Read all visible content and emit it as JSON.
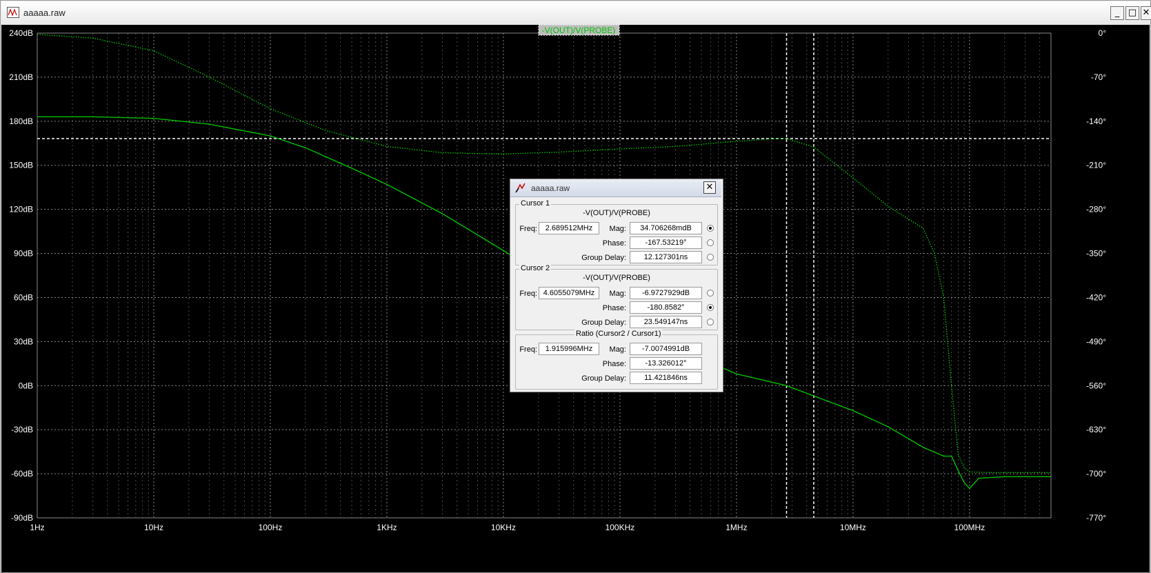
{
  "window": {
    "title": "aaaaa.raw",
    "buttons": {
      "minimize": "_",
      "maximize": "□",
      "close": "✕"
    },
    "app_icon": "waveform-viewer-icon"
  },
  "colors": {
    "background": "#000000",
    "grid": "#8a8a8a",
    "trace": "#00d000",
    "axis_text": "#ffffff",
    "trace_label_bg": "#bdbdbd"
  },
  "chart_data": {
    "type": "line",
    "trace_label": "-V(OUT)/V(PROBE)",
    "x_scale": "log",
    "x_unit": "Hz",
    "x_range": [
      1,
      500000000
    ],
    "x_ticks": [
      {
        "value": 1,
        "label": "1Hz"
      },
      {
        "value": 10,
        "label": "10Hz"
      },
      {
        "value": 100,
        "label": "100Hz"
      },
      {
        "value": 1000,
        "label": "1KHz"
      },
      {
        "value": 10000,
        "label": "10KHz"
      },
      {
        "value": 100000,
        "label": "100KHz"
      },
      {
        "value": 1000000,
        "label": "1MHz"
      },
      {
        "value": 10000000,
        "label": "10MHz"
      },
      {
        "value": 100000000,
        "label": "100MHz"
      }
    ],
    "y_left_range": [
      -90,
      240
    ],
    "y_left_ticks": [
      {
        "value": 240,
        "label": "240dB"
      },
      {
        "value": 210,
        "label": "210dB"
      },
      {
        "value": 180,
        "label": "180dB"
      },
      {
        "value": 150,
        "label": "150dB"
      },
      {
        "value": 120,
        "label": "120dB"
      },
      {
        "value": 90,
        "label": "90dB"
      },
      {
        "value": 60,
        "label": "60dB"
      },
      {
        "value": 30,
        "label": "30dB"
      },
      {
        "value": 0,
        "label": "0dB"
      },
      {
        "value": -30,
        "label": "-30dB"
      },
      {
        "value": -60,
        "label": "-60dB"
      },
      {
        "value": -90,
        "label": "-90dB"
      }
    ],
    "y_right_range": [
      -770,
      0
    ],
    "y_right_ticks": [
      {
        "value": 0,
        "label": "0°"
      },
      {
        "value": -70,
        "label": "-70°"
      },
      {
        "value": -140,
        "label": "-140°"
      },
      {
        "value": -210,
        "label": "-210°"
      },
      {
        "value": -280,
        "label": "-280°"
      },
      {
        "value": -350,
        "label": "-350°"
      },
      {
        "value": -420,
        "label": "-420°"
      },
      {
        "value": -490,
        "label": "-490°"
      },
      {
        "value": -560,
        "label": "-560°"
      },
      {
        "value": -630,
        "label": "-630°"
      },
      {
        "value": -700,
        "label": "-700°"
      },
      {
        "value": -770,
        "label": "-770°"
      }
    ],
    "grid": true,
    "cursors": {
      "vertical_freqs": [
        2689512,
        4605507.9
      ],
      "horizontal_phase": -167.53219
    },
    "series": [
      {
        "axis": "left",
        "style": "solid",
        "x": [
          1,
          3,
          10,
          30,
          100,
          200,
          500,
          1000,
          3000,
          10000,
          30000,
          100000,
          300000,
          1000000,
          2689512,
          4605507.9,
          10000000,
          20000000,
          40000000,
          60000000,
          70000000,
          80000000,
          90000000,
          100000000,
          120000000,
          200000000,
          500000000
        ],
        "y": [
          183,
          183,
          182,
          178,
          170,
          162,
          148,
          137,
          117,
          92,
          68,
          45,
          26,
          8,
          0,
          -7,
          -17,
          -28,
          -42,
          -48,
          -48,
          -58,
          -66,
          -70,
          -63,
          -62,
          -62
        ]
      },
      {
        "axis": "right",
        "style": "dotted",
        "x": [
          1,
          3,
          10,
          30,
          100,
          300,
          1000,
          3000,
          10000,
          30000,
          100000,
          300000,
          1000000,
          2000000,
          2689512,
          4605507.9,
          10000000,
          20000000,
          40000000,
          50000000,
          60000000,
          70000000,
          80000000,
          90000000,
          100000000,
          150000000,
          500000000
        ],
        "y": [
          -2,
          -8,
          -28,
          -70,
          -120,
          -155,
          -180,
          -190,
          -192,
          -189,
          -184,
          -180,
          -172,
          -168,
          -167.5,
          -180.9,
          -230,
          -275,
          -310,
          -350,
          -420,
          -560,
          -670,
          -690,
          -697,
          -698,
          -698
        ]
      }
    ]
  },
  "dialog": {
    "title": "aaaaa.raw",
    "icon": "cursor-probe-icon",
    "close": "✕",
    "cursor1": {
      "label": "Cursor 1",
      "trace": "-V(OUT)/V(PROBE)",
      "freq_label": "Freq:",
      "freq": "2.689512MHz",
      "mag_label": "Mag:",
      "mag": "34.706268mdB",
      "phase_label": "Phase:",
      "phase": "-167.53219°",
      "gd_label": "Group Delay:",
      "gd": "12.127301ns",
      "selected": "mag"
    },
    "cursor2": {
      "label": "Cursor 2",
      "trace": "-V(OUT)/V(PROBE)",
      "freq_label": "Freq:",
      "freq": "4.6055079MHz",
      "mag_label": "Mag:",
      "mag": "-6.9727929dB",
      "phase_label": "Phase:",
      "phase": "-180.8582°",
      "gd_label": "Group Delay:",
      "gd": "23.549147ns",
      "selected": "phase"
    },
    "ratio": {
      "label": "Ratio (Cursor2 / Cursor1)",
      "freq_label": "Freq:",
      "freq": "1.915996MHz",
      "mag_label": "Mag:",
      "mag": "-7.0074991dB",
      "phase_label": "Phase:",
      "phase": "-13.326012°",
      "gd_label": "Group Delay:",
      "gd": "11.421846ns"
    }
  }
}
